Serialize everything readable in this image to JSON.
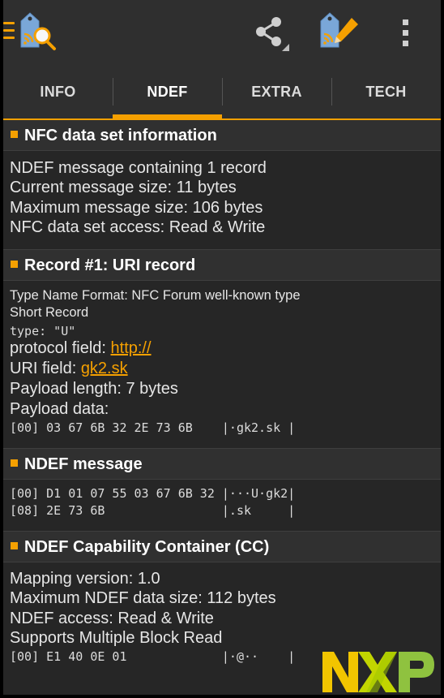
{
  "tabs": [
    {
      "label": "INFO"
    },
    {
      "label": "NDEF"
    },
    {
      "label": "EXTRA"
    },
    {
      "label": "TECH"
    }
  ],
  "selected_tab": "NDEF",
  "accent_color": "#f5a000",
  "icons": {
    "menu": "hamburger-icon",
    "app": "nfc-tag-search-icon",
    "share": "share-icon",
    "write": "nfc-tag-write-icon",
    "overflow": "more-vert-icon"
  },
  "sections": {
    "nfc_info": {
      "title": "NFC data set information",
      "lines": [
        "NDEF message containing 1 record",
        "Current message size: 11 bytes",
        "Maximum message size: 106 bytes",
        "NFC data set access: Read & Write"
      ]
    },
    "record": {
      "title": "Record #1: URI record",
      "tnf": "Type Name Format: NFC Forum well-known type",
      "short": "Short Record",
      "type": "type: \"U\"",
      "protocol_label": "protocol field: ",
      "protocol_value": "http://",
      "uri_label": "URI field: ",
      "uri_value": "gk2.sk",
      "payload_length": "Payload length: 7 bytes",
      "payload_data_label": "Payload data:",
      "payload_hex": "[00] 03 67 6B 32 2E 73 6B    |·gk2.sk |"
    },
    "ndef_message": {
      "title": "NDEF message",
      "hex": [
        "[00] D1 01 07 55 03 67 6B 32 |···U·gk2|",
        "[08] 2E 73 6B                |.sk     |"
      ]
    },
    "cc": {
      "title": "NDEF Capability Container (CC)",
      "lines": [
        "Mapping version: 1.0",
        "Maximum NDEF data size: 112 bytes",
        "NDEF access: Read & Write",
        "Supports Multiple Block Read"
      ],
      "hex": "[00] E1 40 0E 01             |·@··    |"
    }
  },
  "brand": {
    "logo_text": "NXP"
  }
}
